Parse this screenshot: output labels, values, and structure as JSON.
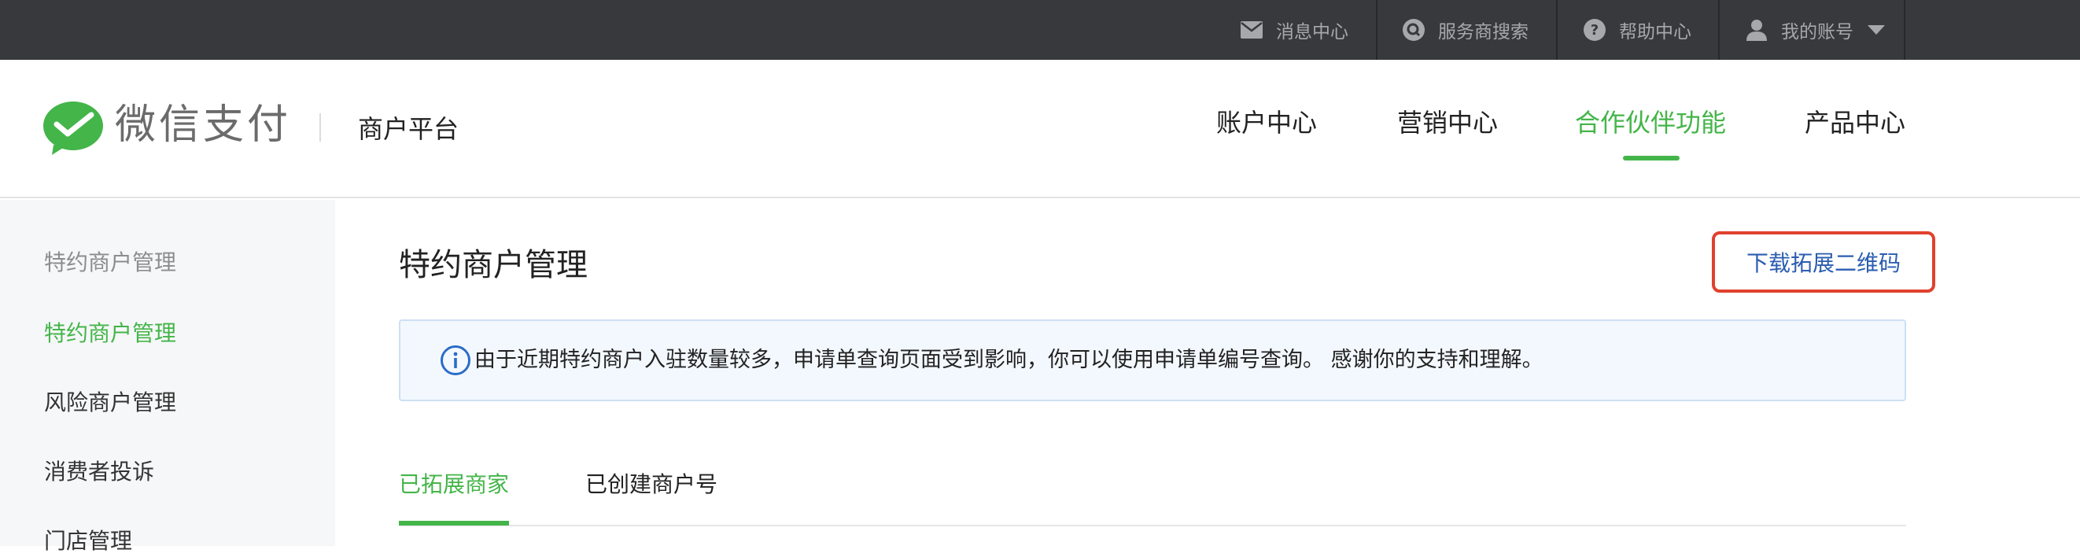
{
  "topbar": {
    "items": [
      {
        "icon": "envelope-icon",
        "label": "消息中心"
      },
      {
        "icon": "search-provider-icon",
        "label": "服务商搜索"
      },
      {
        "icon": "help-icon",
        "label": "帮助中心"
      },
      {
        "icon": "user-icon",
        "label": "我的账号"
      }
    ]
  },
  "header": {
    "brand": "微信支付",
    "platform": "商户平台",
    "nav": [
      {
        "label": "账户中心",
        "active": false
      },
      {
        "label": "营销中心",
        "active": false
      },
      {
        "label": "合作伙伴功能",
        "active": true
      },
      {
        "label": "产品中心",
        "active": false
      }
    ]
  },
  "sidebar": {
    "items": [
      {
        "label": "特约商户管理",
        "state": "group"
      },
      {
        "label": "特约商户管理",
        "state": "active"
      },
      {
        "label": "风险商户管理",
        "state": "normal"
      },
      {
        "label": "消费者投诉",
        "state": "normal"
      },
      {
        "label": "门店管理",
        "state": "normal"
      }
    ]
  },
  "main": {
    "title": "特约商户管理",
    "download_button": "下载拓展二维码",
    "notice": "由于近期特约商户入驻数量较多，申请单查询页面受到影响，你可以使用申请单编号查询。 感谢你的支持和理解。",
    "tabs": [
      {
        "label": "已拓展商家",
        "active": true
      },
      {
        "label": "已创建商户号",
        "active": false
      }
    ]
  },
  "colors": {
    "accent": "#44b549",
    "topbar": "#38393d",
    "link": "#2a5db0",
    "highlight_border": "#e0412d"
  }
}
